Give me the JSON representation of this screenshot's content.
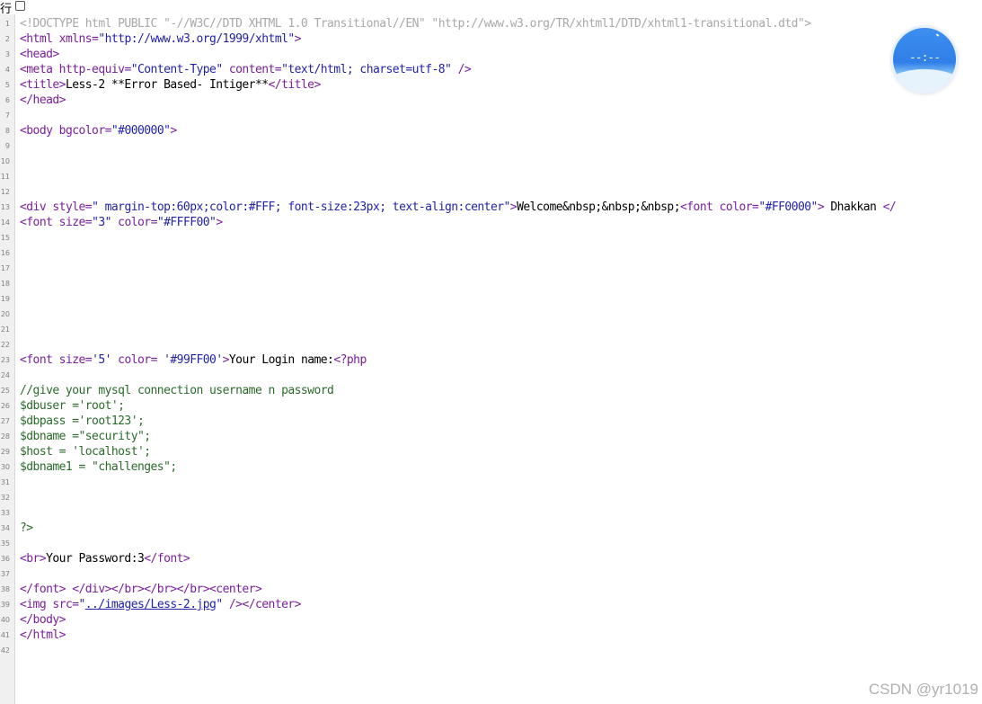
{
  "toolbar": {
    "wrap_label": "行",
    "wrap_checked": false
  },
  "widget": {
    "time_display": "--:--"
  },
  "watermark": "CSDN @yr1019",
  "code_lines": [
    {
      "n": "1",
      "tokens": [
        {
          "t": "doctype",
          "v": "<!DOCTYPE html PUBLIC \"-//W3C//DTD XHTML 1.0 Transitional//EN\" \"http://www.w3.org/TR/xhtml1/DTD/xhtml1-transitional.dtd\">"
        }
      ]
    },
    {
      "n": "2",
      "tokens": [
        {
          "t": "tag",
          "v": "<html "
        },
        {
          "t": "attr",
          "v": "xmlns="
        },
        {
          "t": "str",
          "v": "\"http://www.w3.org/1999/xhtml\""
        },
        {
          "t": "tag",
          "v": ">"
        }
      ]
    },
    {
      "n": "3",
      "tokens": [
        {
          "t": "tag",
          "v": "<head>"
        }
      ]
    },
    {
      "n": "4",
      "tokens": [
        {
          "t": "tag",
          "v": "<meta "
        },
        {
          "t": "attr",
          "v": "http-equiv="
        },
        {
          "t": "str",
          "v": "\"Content-Type\""
        },
        {
          "t": "attr",
          "v": " content="
        },
        {
          "t": "str",
          "v": "\"text/html; charset=utf-8\""
        },
        {
          "t": "tag",
          "v": " />"
        }
      ]
    },
    {
      "n": "5",
      "tokens": [
        {
          "t": "tag",
          "v": "<title>"
        },
        {
          "t": "text",
          "v": "Less-2 **Error Based- Intiger**"
        },
        {
          "t": "tag",
          "v": "</title>"
        }
      ]
    },
    {
      "n": "6",
      "tokens": [
        {
          "t": "tag",
          "v": "</head>"
        }
      ]
    },
    {
      "n": "7",
      "tokens": []
    },
    {
      "n": "8",
      "tokens": [
        {
          "t": "tag",
          "v": "<body "
        },
        {
          "t": "attr",
          "v": "bgcolor="
        },
        {
          "t": "str",
          "v": "\"#000000\""
        },
        {
          "t": "tag",
          "v": ">"
        }
      ]
    },
    {
      "n": "9",
      "tokens": []
    },
    {
      "n": "10",
      "tokens": []
    },
    {
      "n": "11",
      "tokens": []
    },
    {
      "n": "12",
      "tokens": []
    },
    {
      "n": "13",
      "tokens": [
        {
          "t": "tag",
          "v": "<div "
        },
        {
          "t": "attr",
          "v": "style="
        },
        {
          "t": "str",
          "v": "\" margin-top:60px;color:#FFF; font-size:23px; text-align:center\""
        },
        {
          "t": "tag",
          "v": ">"
        },
        {
          "t": "text",
          "v": "Welcome&nbsp;&nbsp;&nbsp;"
        },
        {
          "t": "tag",
          "v": "<font "
        },
        {
          "t": "attr",
          "v": "color="
        },
        {
          "t": "str",
          "v": "\"#FF0000\""
        },
        {
          "t": "tag",
          "v": ">"
        },
        {
          "t": "text",
          "v": " Dhakkan "
        },
        {
          "t": "tag",
          "v": "</"
        }
      ]
    },
    {
      "n": "14",
      "tokens": [
        {
          "t": "tag",
          "v": "<font "
        },
        {
          "t": "attr",
          "v": "size="
        },
        {
          "t": "str",
          "v": "\"3\""
        },
        {
          "t": "attr",
          "v": " color="
        },
        {
          "t": "str",
          "v": "\"#FFFF00\""
        },
        {
          "t": "tag",
          "v": ">"
        }
      ]
    },
    {
      "n": "15",
      "tokens": []
    },
    {
      "n": "16",
      "tokens": []
    },
    {
      "n": "17",
      "tokens": []
    },
    {
      "n": "18",
      "tokens": []
    },
    {
      "n": "19",
      "tokens": []
    },
    {
      "n": "20",
      "tokens": []
    },
    {
      "n": "21",
      "tokens": []
    },
    {
      "n": "22",
      "tokens": []
    },
    {
      "n": "23",
      "tokens": [
        {
          "t": "tag",
          "v": "<font "
        },
        {
          "t": "attr",
          "v": "size="
        },
        {
          "t": "str",
          "v": "'5'"
        },
        {
          "t": "attr",
          "v": " color= "
        },
        {
          "t": "str",
          "v": "'#99FF00'"
        },
        {
          "t": "tag",
          "v": ">"
        },
        {
          "t": "text",
          "v": "Your Login name:"
        },
        {
          "t": "tag",
          "v": "<?php"
        }
      ]
    },
    {
      "n": "24",
      "tokens": []
    },
    {
      "n": "25",
      "tokens": [
        {
          "t": "php",
          "v": "//give your mysql connection username n password"
        }
      ]
    },
    {
      "n": "26",
      "tokens": [
        {
          "t": "php",
          "v": "$dbuser ='root';"
        }
      ]
    },
    {
      "n": "27",
      "tokens": [
        {
          "t": "php",
          "v": "$dbpass ='root123';"
        }
      ]
    },
    {
      "n": "28",
      "tokens": [
        {
          "t": "php",
          "v": "$dbname =\"security\";"
        }
      ]
    },
    {
      "n": "29",
      "tokens": [
        {
          "t": "php",
          "v": "$host = 'localhost';"
        }
      ]
    },
    {
      "n": "30",
      "tokens": [
        {
          "t": "php",
          "v": "$dbname1 = \"challenges\";"
        }
      ]
    },
    {
      "n": "31",
      "tokens": []
    },
    {
      "n": "32",
      "tokens": []
    },
    {
      "n": "33",
      "tokens": []
    },
    {
      "n": "34",
      "tokens": [
        {
          "t": "php",
          "v": "?>"
        }
      ]
    },
    {
      "n": "35",
      "tokens": []
    },
    {
      "n": "36",
      "tokens": [
        {
          "t": "tag",
          "v": "<br>"
        },
        {
          "t": "text",
          "v": "Your Password:3"
        },
        {
          "t": "tag",
          "v": "</font>"
        }
      ]
    },
    {
      "n": "37",
      "tokens": []
    },
    {
      "n": "38",
      "tokens": [
        {
          "t": "tag",
          "v": "</font> </div></br></br></br><center>"
        }
      ]
    },
    {
      "n": "39",
      "tokens": [
        {
          "t": "tag",
          "v": "<img "
        },
        {
          "t": "attr",
          "v": "src="
        },
        {
          "t": "str",
          "v": "\""
        },
        {
          "t": "link",
          "v": "../images/Less-2.jpg"
        },
        {
          "t": "str",
          "v": "\""
        },
        {
          "t": "tag",
          "v": " /></center>"
        }
      ]
    },
    {
      "n": "40",
      "tokens": [
        {
          "t": "tag",
          "v": "</body>"
        }
      ]
    },
    {
      "n": "41",
      "tokens": [
        {
          "t": "tag",
          "v": "</html>"
        }
      ]
    },
    {
      "n": "42",
      "tokens": []
    }
  ]
}
